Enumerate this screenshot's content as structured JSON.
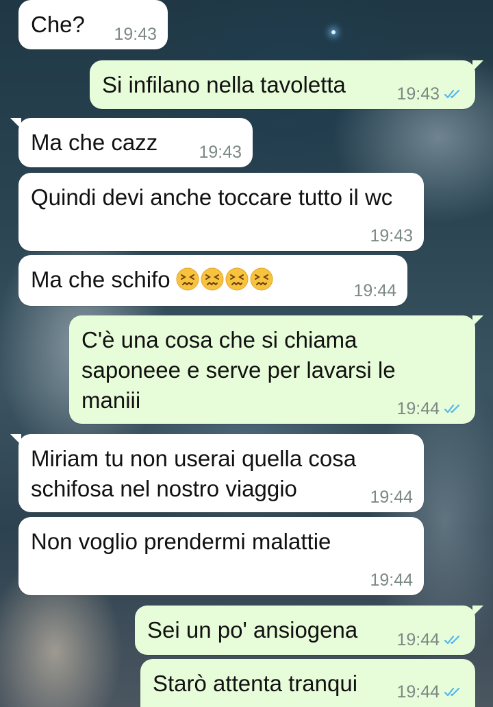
{
  "chat": {
    "messages": [
      {
        "id": "m1",
        "direction": "incoming",
        "text": "Che?",
        "time": "19:43"
      },
      {
        "id": "m2",
        "direction": "outgoing",
        "text": "Si infilano nella tavoletta",
        "time": "19:43",
        "status_icon": "double-check-read"
      },
      {
        "id": "m3",
        "direction": "incoming",
        "text": "Ma che cazz",
        "time": "19:43"
      },
      {
        "id": "m4",
        "direction": "incoming",
        "text": "Quindi devi anche toccare tutto il wc",
        "time": "19:43"
      },
      {
        "id": "m5",
        "direction": "incoming",
        "text": "Ma che schifo",
        "emoji": "😣😣😣😣",
        "emoji_name": "persevering-face",
        "time": "19:44"
      },
      {
        "id": "m6",
        "direction": "outgoing",
        "text": "C'è una cosa che si chiama saponeee e serve per lavarsi le maniii",
        "time": "19:44",
        "status_icon": "double-check-read"
      },
      {
        "id": "m7",
        "direction": "incoming",
        "text": "Miriam tu non userai quella cosa schifosa nel nostro viaggio",
        "time": "19:44"
      },
      {
        "id": "m8",
        "direction": "incoming",
        "text": "Non voglio prendermi malattie",
        "time": "19:44"
      },
      {
        "id": "m9",
        "direction": "outgoing",
        "text": "Sei un po' ansiogena",
        "time": "19:44",
        "status_icon": "double-check-read"
      },
      {
        "id": "m10",
        "direction": "outgoing",
        "text": "Starò attenta tranqui",
        "time": "19:44",
        "status_icon": "double-check-read"
      }
    ]
  },
  "colors": {
    "incoming_bubble": "#ffffff",
    "outgoing_bubble": "#e7fcd9",
    "timestamp": "#7c8a84",
    "read_ticks": "#4fb6ec"
  }
}
